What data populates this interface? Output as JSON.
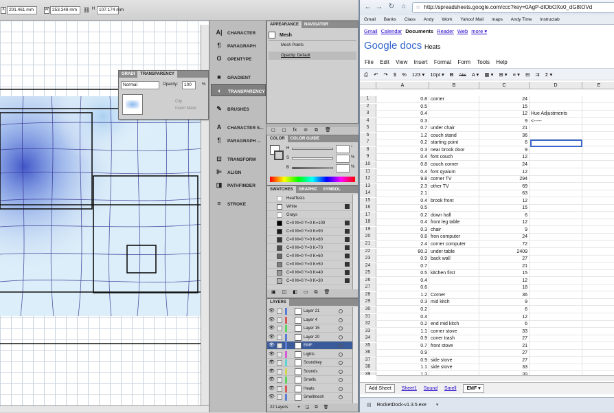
{
  "illustrator": {
    "controls": {
      "x": "201.461 mm",
      "y": "253.348 mm",
      "h": "107.174 mm"
    },
    "dock": [
      {
        "icon": "character-icon",
        "glyph": "A|",
        "label": "CHARACTER"
      },
      {
        "icon": "paragraph-icon",
        "glyph": "¶",
        "label": "PARAGRAPH"
      },
      {
        "icon": "opentype-icon",
        "glyph": "O",
        "label": "OPENTYPE"
      },
      {
        "icon": "gradient-icon",
        "glyph": "■",
        "label": "GRADIENT"
      },
      {
        "icon": "transparency-icon",
        "glyph": "◐",
        "label": "TRANSPARENCY"
      },
      {
        "icon": "brushes-icon",
        "glyph": "✎",
        "label": "BRUSHES"
      },
      {
        "icon": "character-styles-icon",
        "glyph": "A",
        "label": "CHARACTER S..."
      },
      {
        "icon": "paragraph-styles-icon",
        "glyph": "¶",
        "label": "PARAGRAPH ..."
      },
      {
        "icon": "transform-icon",
        "glyph": "⊡",
        "label": "TRANSFORM"
      },
      {
        "icon": "align-icon",
        "glyph": "⊫",
        "label": "ALIGN"
      },
      {
        "icon": "pathfinder-icon",
        "glyph": "◨",
        "label": "PATHFINDER"
      },
      {
        "icon": "stroke-icon",
        "glyph": "≡",
        "label": "STROKE"
      }
    ],
    "appearance": {
      "tabs": [
        "APPEARANCE",
        "NAVIGATOR"
      ],
      "object": "Mesh",
      "rows": [
        "Mesh Points",
        "Opacity: Default"
      ]
    },
    "transparency": {
      "tabs": [
        "GRADI",
        "TRANSPARENCY"
      ],
      "mode": "Normal",
      "opacity_label": "Opacity:",
      "opacity": "100",
      "unit": "%",
      "clip": "Clip",
      "invert": "Invert Mask"
    },
    "color": {
      "tabs": [
        "COLOR",
        "COLOR GUIDE"
      ],
      "channels": [
        "H",
        "S",
        "B"
      ],
      "units": [
        "°",
        "%",
        "%"
      ]
    },
    "swatches": {
      "tabs": [
        "SWATCHES",
        "GRAPHIC",
        "SYMBOL"
      ],
      "items": [
        {
          "name": "HeatTests",
          "color": "#ffffff",
          "folder": true
        },
        {
          "name": "White",
          "color": "#ffffff",
          "folder": false
        },
        {
          "name": "Grays",
          "color": "#ffffff",
          "folder": true
        },
        {
          "name": "C=0 M=0 Y=0 K=100",
          "color": "#000000",
          "folder": false
        },
        {
          "name": "C=0 M=0 Y=0 K=90",
          "color": "#1a1a1a",
          "folder": false
        },
        {
          "name": "C=0 M=0 Y=0 K=80",
          "color": "#333333",
          "folder": false
        },
        {
          "name": "C=0 M=0 Y=0 K=70",
          "color": "#4d4d4d",
          "folder": false
        },
        {
          "name": "C=0 M=0 Y=0 K=60",
          "color": "#666666",
          "folder": false
        },
        {
          "name": "C=0 M=0 Y=0 K=50",
          "color": "#808080",
          "folder": false
        },
        {
          "name": "C=0 M=0 Y=0 K=40",
          "color": "#999999",
          "folder": false
        },
        {
          "name": "C=0 M=0 Y=0 K=30",
          "color": "#b3b3b3",
          "folder": false
        }
      ]
    },
    "layers": {
      "tab": "LAYERS",
      "count": "22 Layers",
      "items": [
        {
          "name": "Layer 21",
          "selected": false,
          "color": "#5b7bd5"
        },
        {
          "name": "Layer 4",
          "selected": false,
          "color": "#d55b5b"
        },
        {
          "name": "Layer 15",
          "selected": false,
          "color": "#5bd55b"
        },
        {
          "name": "Layer 20",
          "selected": false,
          "color": "#5b7bd5"
        },
        {
          "name": "EMF",
          "selected": true,
          "color": "#5b7bd5"
        },
        {
          "name": "Lights",
          "selected": false,
          "color": "#d55bd5"
        },
        {
          "name": "Soundkey",
          "selected": false,
          "color": "#5bd5d5"
        },
        {
          "name": "Sounds",
          "selected": false,
          "color": "#d5d55b"
        },
        {
          "name": "Smells",
          "selected": false,
          "color": "#5bd55b"
        },
        {
          "name": "Heats",
          "selected": false,
          "color": "#d55b5b"
        },
        {
          "name": "Smellmesh",
          "selected": false,
          "color": "#5b7bd5"
        }
      ]
    }
  },
  "browser": {
    "url": "http://spreadsheets.google.com/ccc?key=0AgP-dlObOXo0_dG8tOVd",
    "bookmarks": [
      "Gmail",
      "Banks",
      "Class",
      "Andy",
      "Work",
      "Yahoo! Mail",
      "maps",
      "Andy Time",
      "Instructab"
    ]
  },
  "docs": {
    "toplinks": [
      "Gmail",
      "Calendar",
      "Documents",
      "Reader",
      "Web",
      "more ▾"
    ],
    "logo": "Google docs",
    "title": "Heats",
    "menu": [
      "File",
      "Edit",
      "View",
      "Insert",
      "Format",
      "Form",
      "Tools",
      "Help"
    ],
    "toolbar": [
      "⎙",
      "↶",
      "↷",
      "$",
      "%",
      "123 ▾",
      "10pt ▾",
      "B",
      "Abc",
      "A ▾",
      "▦ ▾",
      "⊞ ▾",
      "≡ ▾",
      "⊟",
      "⇉",
      "Σ ▾"
    ],
    "columns": [
      "A",
      "B",
      "C",
      "D",
      "E"
    ],
    "rows": [
      {
        "n": "1",
        "a": "0.8",
        "b": "corner",
        "c": "24",
        "d": ""
      },
      {
        "n": "2",
        "a": "0.5",
        "b": "",
        "c": "15",
        "d": ""
      },
      {
        "n": "3",
        "a": "0.4",
        "b": "",
        "c": "12",
        "d": "Hue Adjustments"
      },
      {
        "n": "4",
        "a": "0.3",
        "b": "",
        "c": "9",
        "d": "<-----"
      },
      {
        "n": "5",
        "a": "0.7",
        "b": "under chair",
        "c": "21",
        "d": ""
      },
      {
        "n": "6",
        "a": "1.2",
        "b": "couch stand",
        "c": "36",
        "d": ""
      },
      {
        "n": "7",
        "a": "0.2",
        "b": "starting point",
        "c": "6",
        "d": ""
      },
      {
        "n": "8",
        "a": "0.3",
        "b": "near brook door",
        "c": "9",
        "d": ""
      },
      {
        "n": "9",
        "a": "0.4",
        "b": "font couch",
        "c": "12",
        "d": ""
      },
      {
        "n": "10",
        "a": "0.8",
        "b": "couch corner",
        "c": "24",
        "d": ""
      },
      {
        "n": "11",
        "a": "0.4",
        "b": "font qyaium",
        "c": "12",
        "d": ""
      },
      {
        "n": "12",
        "a": "9.8",
        "b": "corner TV",
        "c": "294",
        "d": ""
      },
      {
        "n": "13",
        "a": "2.3",
        "b": "other TV",
        "c": "69",
        "d": ""
      },
      {
        "n": "14",
        "a": "2.1",
        "b": "",
        "c": "63",
        "d": ""
      },
      {
        "n": "15",
        "a": "0.4",
        "b": "brook front",
        "c": "12",
        "d": ""
      },
      {
        "n": "16",
        "a": "0.5",
        "b": "",
        "c": "15",
        "d": ""
      },
      {
        "n": "17",
        "a": "0.2",
        "b": "down hall",
        "c": "6",
        "d": ""
      },
      {
        "n": "18",
        "a": "0.4",
        "b": "front leg table",
        "c": "12",
        "d": ""
      },
      {
        "n": "19",
        "a": "0.3",
        "b": "chair",
        "c": "9",
        "d": ""
      },
      {
        "n": "20",
        "a": "0.8",
        "b": "fron computer",
        "c": "24",
        "d": ""
      },
      {
        "n": "21",
        "a": "2.4",
        "b": "corner computer",
        "c": "72",
        "d": ""
      },
      {
        "n": "22",
        "a": "80.3",
        "b": "under table",
        "c": "2409",
        "d": ""
      },
      {
        "n": "23",
        "a": "0.9",
        "b": "back wall",
        "c": "27",
        "d": ""
      },
      {
        "n": "24",
        "a": "0.7",
        "b": "",
        "c": "21",
        "d": ""
      },
      {
        "n": "25",
        "a": "0.5",
        "b": "kitchen first",
        "c": "15",
        "d": ""
      },
      {
        "n": "26",
        "a": "0.4",
        "b": "",
        "c": "12",
        "d": ""
      },
      {
        "n": "27",
        "a": "0.6",
        "b": "",
        "c": "18",
        "d": ""
      },
      {
        "n": "28",
        "a": "1.2",
        "b": "Corner",
        "c": "36",
        "d": ""
      },
      {
        "n": "29",
        "a": "0.3",
        "b": "mid kitch",
        "c": "9",
        "d": ""
      },
      {
        "n": "30",
        "a": "0.2",
        "b": "",
        "c": "6",
        "d": ""
      },
      {
        "n": "31",
        "a": "0.4",
        "b": "",
        "c": "12",
        "d": ""
      },
      {
        "n": "32",
        "a": "0.2",
        "b": "end mid kitch",
        "c": "6",
        "d": ""
      },
      {
        "n": "33",
        "a": "1.1",
        "b": "corner stove",
        "c": "33",
        "d": ""
      },
      {
        "n": "34",
        "a": "0.9",
        "b": "coner trash",
        "c": "27",
        "d": ""
      },
      {
        "n": "35",
        "a": "0.7",
        "b": "front stove",
        "c": "21",
        "d": ""
      },
      {
        "n": "36",
        "a": "0.9",
        "b": "",
        "c": "27",
        "d": ""
      },
      {
        "n": "37",
        "a": "0.9",
        "b": "side stove",
        "c": "27",
        "d": ""
      },
      {
        "n": "38",
        "a": "1.1",
        "b": "side stove",
        "c": "33",
        "d": ""
      },
      {
        "n": "39",
        "a": "1.3",
        "b": "",
        "c": "39",
        "d": ""
      }
    ],
    "add_sheet": "Add Sheet",
    "sheets": [
      "Sheet1",
      "Sound",
      "Smell",
      "EMF ▾"
    ],
    "download": "RocketDock-v1.3.5.exe"
  }
}
